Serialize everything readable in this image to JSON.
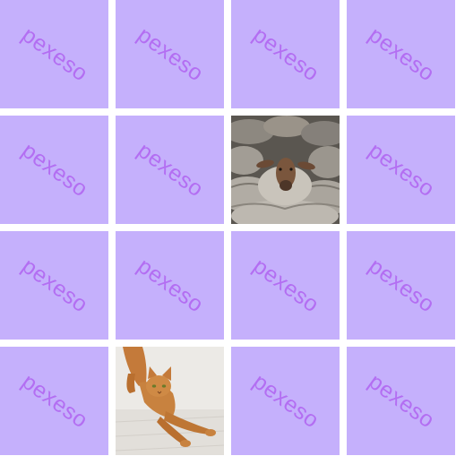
{
  "game": {
    "grid": {
      "rows": 4,
      "cols": 4
    },
    "card_back_label": "pexeso",
    "colors": {
      "card_back": "#c5b0fc",
      "card_back_text": "#b36ef2",
      "gutter": "#ffffff"
    },
    "cards": [
      {
        "state": "face-down"
      },
      {
        "state": "face-down"
      },
      {
        "state": "face-down"
      },
      {
        "state": "face-down"
      },
      {
        "state": "face-down"
      },
      {
        "state": "face-down"
      },
      {
        "state": "face-up",
        "image": "sheep-in-flock"
      },
      {
        "state": "face-down"
      },
      {
        "state": "face-down"
      },
      {
        "state": "face-down"
      },
      {
        "state": "face-down"
      },
      {
        "state": "face-down"
      },
      {
        "state": "face-down"
      },
      {
        "state": "face-up",
        "image": "stretching-cat"
      },
      {
        "state": "face-down"
      },
      {
        "state": "face-down"
      }
    ]
  }
}
